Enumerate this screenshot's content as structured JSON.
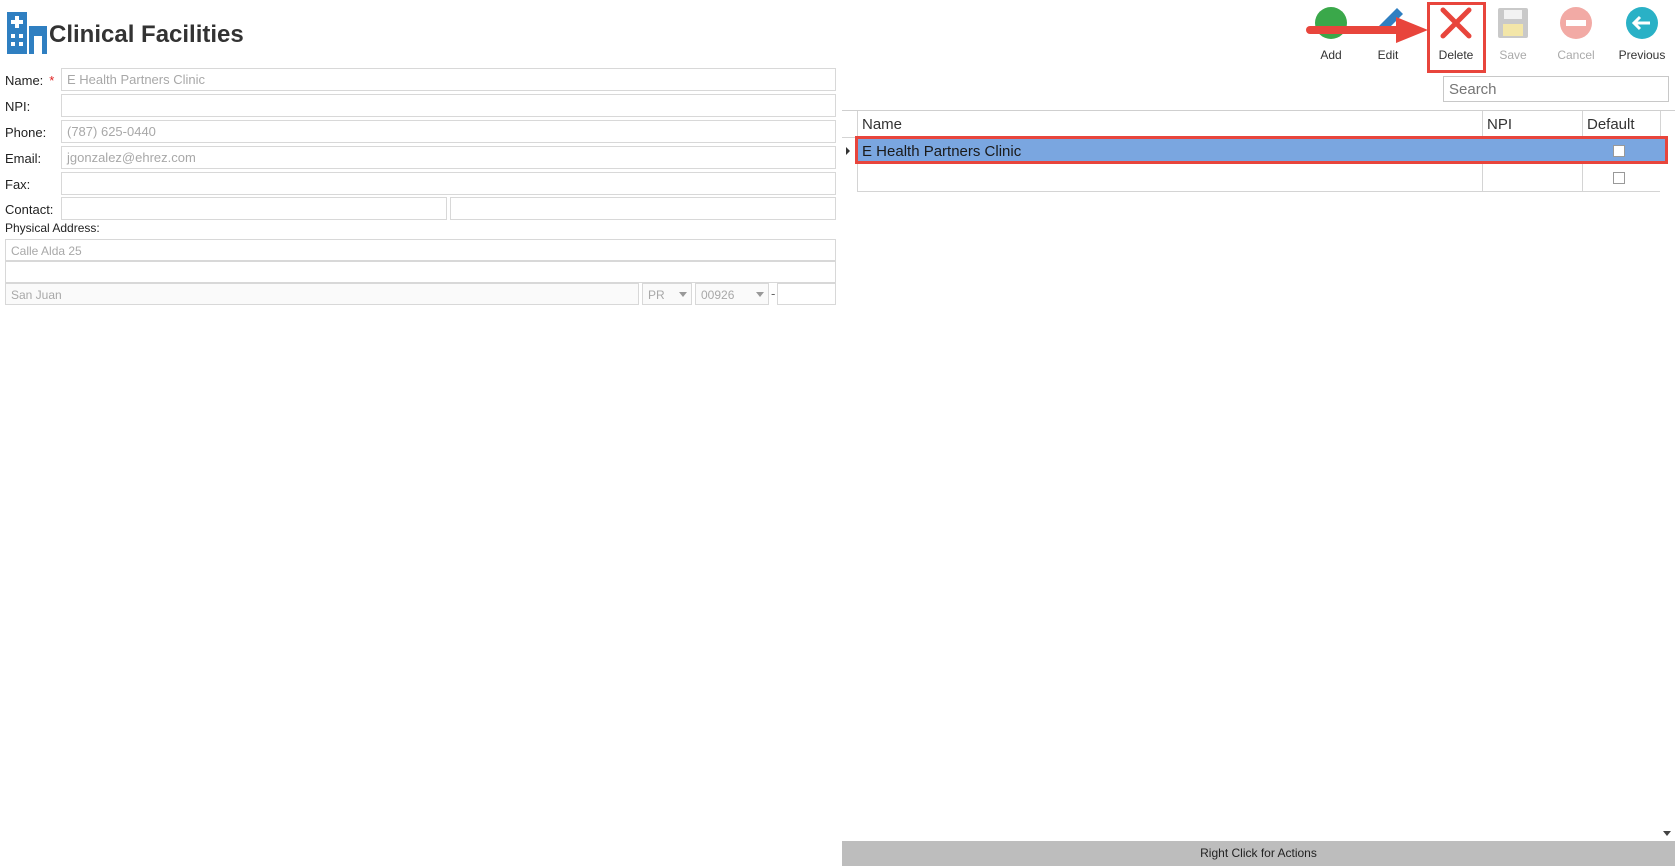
{
  "header": {
    "title": "Clinical Facilities",
    "icon": "hospital-building-icon"
  },
  "form": {
    "name_label": "Name:",
    "required_marker": "*",
    "name_value": "E Health Partners Clinic",
    "npi_label": "NPI:",
    "npi_value": "",
    "phone_label": "Phone:",
    "phone_value": "(787) 625-0440",
    "email_label": "Email:",
    "email_value": "jgonzalez@ehrez.com",
    "fax_label": "Fax:",
    "fax_value": "",
    "contact_label": "Contact:",
    "contact_first": "",
    "contact_second": "",
    "physical_address_label": "Physical Address:",
    "address_line1": "Calle Alda 25",
    "address_line2": "",
    "city": "San Juan",
    "state": "PR",
    "zip": "00926",
    "zip_ext_dash": "-",
    "zip_ext": ""
  },
  "toolbar": {
    "add": "Add",
    "edit": "Edit",
    "delete": "Delete",
    "save": "Save",
    "cancel": "Cancel",
    "previous": "Previous"
  },
  "search": {
    "placeholder": "Search"
  },
  "grid": {
    "columns": [
      "Name",
      "NPI",
      "Default"
    ],
    "rows": [
      {
        "name": "E Health Partners Clinic",
        "npi": "",
        "default": false,
        "selected": true
      },
      {
        "name": "",
        "npi": "",
        "default": false,
        "selected": false
      }
    ]
  },
  "footer": {
    "text": "Right Click for Actions"
  },
  "colors": {
    "selection": "#7aa6e0",
    "annotation_red": "#e8453c",
    "add_green": "#3aa84a",
    "edit_blue": "#2f7fc1",
    "previous_teal": "#2ab1c6"
  }
}
